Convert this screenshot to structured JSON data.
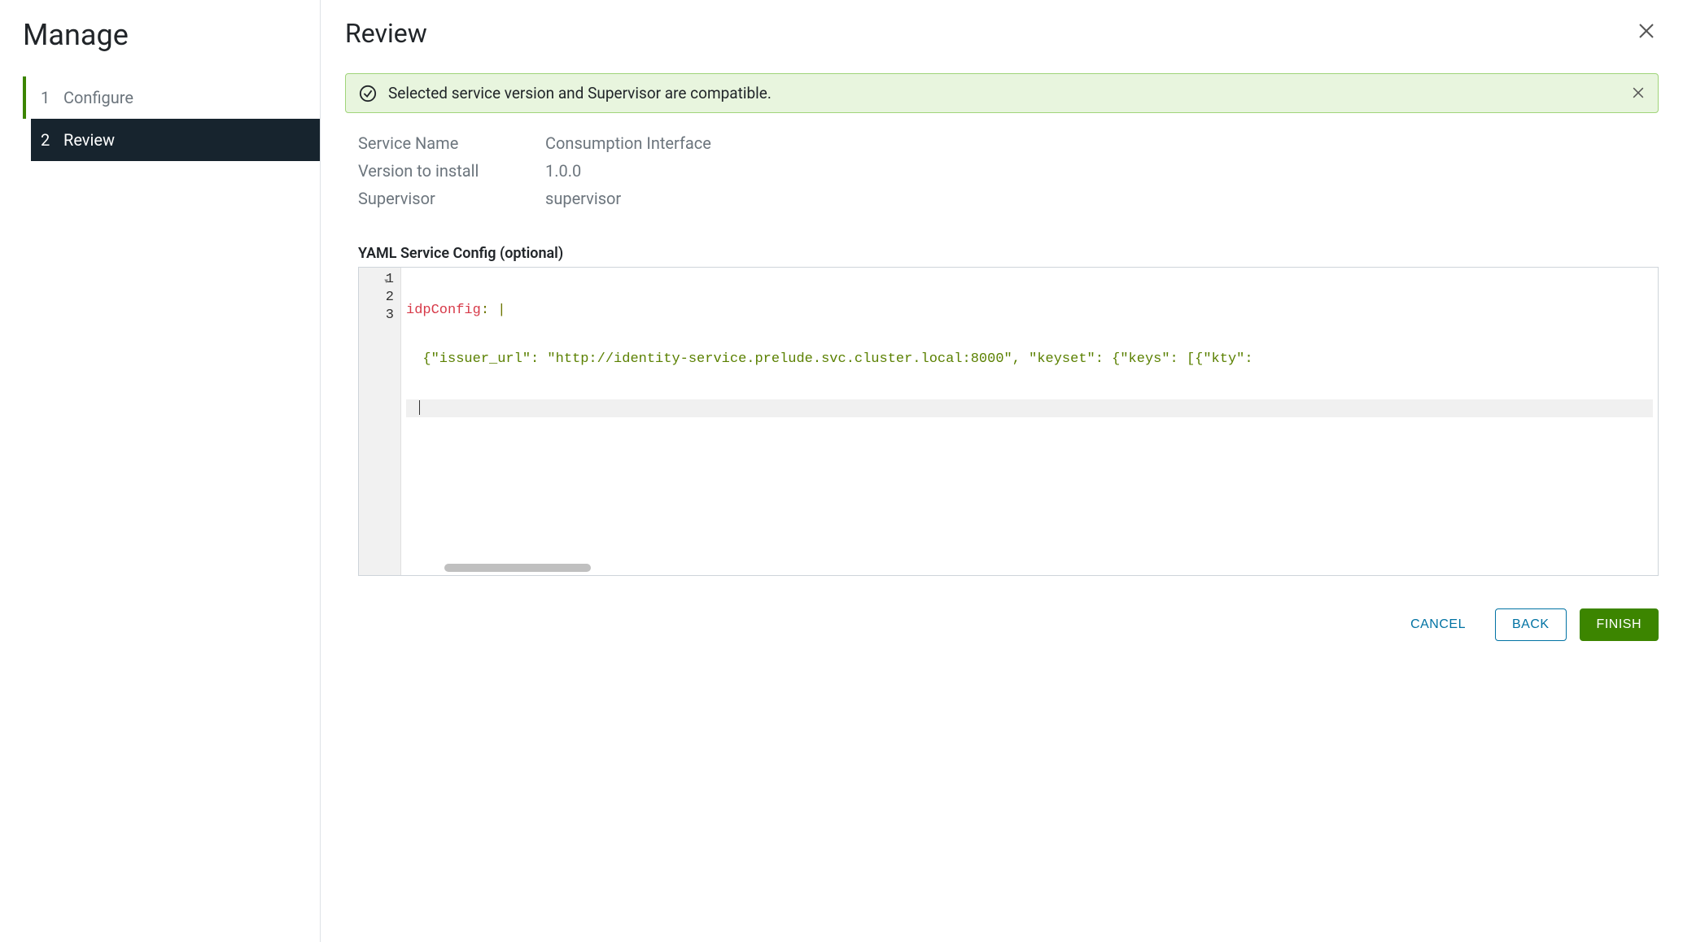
{
  "sidebar": {
    "title": "Manage",
    "steps": [
      {
        "number": "1",
        "label": "Configure"
      },
      {
        "number": "2",
        "label": "Review"
      }
    ]
  },
  "header": {
    "title": "Review"
  },
  "alert": {
    "text": "Selected service version and Supervisor are compatible."
  },
  "details": {
    "service_name_label": "Service Name",
    "service_name_value": "Consumption Interface",
    "version_label": "Version to install",
    "version_value": "1.0.0",
    "supervisor_label": "Supervisor",
    "supervisor_value": "supervisor"
  },
  "yaml": {
    "section_label": "YAML Service Config (optional)",
    "line1_key": "idpConfig",
    "line1_colon_pipe": ": |",
    "line2_content": "  {\"issuer_url\": \"http://identity-service.prelude.svc.cluster.local:8000\", \"keyset\": {\"keys\": [{\"kty\":",
    "gutter": [
      "1",
      "2",
      "3"
    ]
  },
  "footer": {
    "cancel": "CANCEL",
    "back": "BACK",
    "finish": "FINISH"
  }
}
